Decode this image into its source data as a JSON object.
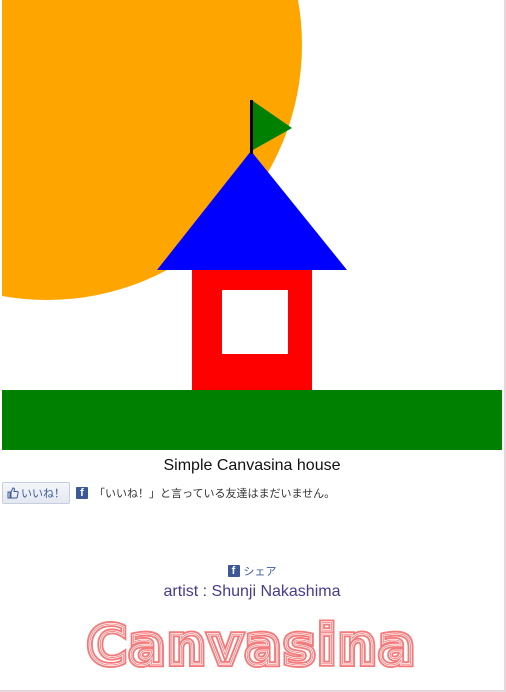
{
  "artwork": {
    "colors": {
      "sun": "#FFA500",
      "ground": "#008000",
      "roof": "#0000FF",
      "house": "#FF0000",
      "flag": "#008000",
      "pole": "#000000"
    }
  },
  "caption": "Simple Canvasina house",
  "social": {
    "like_label": "いいね！",
    "like_count_text": "「いいね！」と言っている友達はまだいません。",
    "share_label": "シェア"
  },
  "artist_line": "artist : Shunji Nakashima",
  "brand": {
    "name": "Canvasina",
    "color": "#F47B7B"
  }
}
